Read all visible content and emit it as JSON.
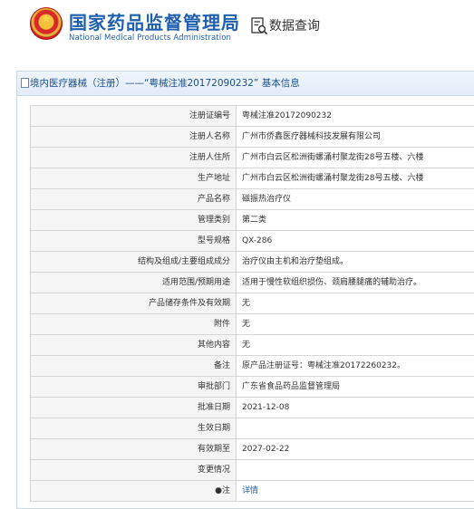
{
  "header": {
    "cn_title": "国家药品监督管理局",
    "en_title": "National Medical Products Administration",
    "query_label": "数据查询",
    "emblem_icon": "national-emblem-icon",
    "query_icon": "data-query-icon"
  },
  "panel": {
    "title": "境内医疗器械（注册）——“粤械注准20172090232” 基本信息",
    "rows": [
      {
        "label": "注册证编号",
        "value": "粤械注准20172090232"
      },
      {
        "label": "注册人名称",
        "value": "广州市侨鑫医疗器械科技发展有限公司"
      },
      {
        "label": "注册人住所",
        "value": "广州市白云区松洲街螺涌村聚龙街28号五楼、六楼"
      },
      {
        "label": "生产地址",
        "value": "广州市白云区松洲街螺涌村聚龙街28号五楼、六楼"
      },
      {
        "label": "产品名称",
        "value": "磁振热治疗仪"
      },
      {
        "label": "管理类别",
        "value": "第二类"
      },
      {
        "label": "型号规格",
        "value": "QX-286"
      },
      {
        "label": "结构及组成/主要组成成分",
        "value": "治疗仪由主机和治疗垫组成。"
      },
      {
        "label": "适用范围/预期用途",
        "value": "适用于慢性软组织损伤、颈肩腰腿痛的辅助治疗。"
      },
      {
        "label": "产品储存条件及有效期",
        "value": "无"
      },
      {
        "label": "附件",
        "value": "无"
      },
      {
        "label": "其他内容",
        "value": "无"
      },
      {
        "label": "备注",
        "value": "原产品注册证号：粤械注准20172260232。"
      },
      {
        "label": "审批部门",
        "value": "广东省食品药品监督管理局"
      },
      {
        "label": "批准日期",
        "value": "2021-12-08"
      },
      {
        "label": "生效日期",
        "value": ""
      },
      {
        "label": "有效期至",
        "value": "2027-02-22"
      },
      {
        "label": "变更情况",
        "value": ""
      },
      {
        "label": "●注",
        "value": "详情"
      }
    ]
  },
  "colors": {
    "brand_blue": "#1e5fae",
    "label_bg": "#f5f5f5",
    "border": "#d6d6d6"
  }
}
